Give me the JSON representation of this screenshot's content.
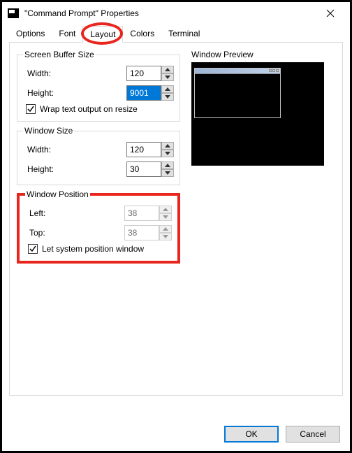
{
  "window": {
    "title": "\"Command Prompt\" Properties"
  },
  "tabs": {
    "options": "Options",
    "font": "Font",
    "layout": "Layout",
    "colors": "Colors",
    "terminal": "Terminal"
  },
  "buffer": {
    "legend": "Screen Buffer Size",
    "width_label": "Width:",
    "width_value": "120",
    "height_label": "Height:",
    "height_value": "9001",
    "wrap_label": "Wrap text output on resize",
    "wrap_checked": true
  },
  "winsize": {
    "legend": "Window Size",
    "width_label": "Width:",
    "width_value": "120",
    "height_label": "Height:",
    "height_value": "30"
  },
  "winpos": {
    "legend": "Window Position",
    "left_label": "Left:",
    "left_value": "38",
    "top_label": "Top:",
    "top_value": "38",
    "syspos_label": "Let system position window",
    "syspos_checked": true
  },
  "preview": {
    "label": "Window Preview"
  },
  "buttons": {
    "ok": "OK",
    "cancel": "Cancel"
  }
}
